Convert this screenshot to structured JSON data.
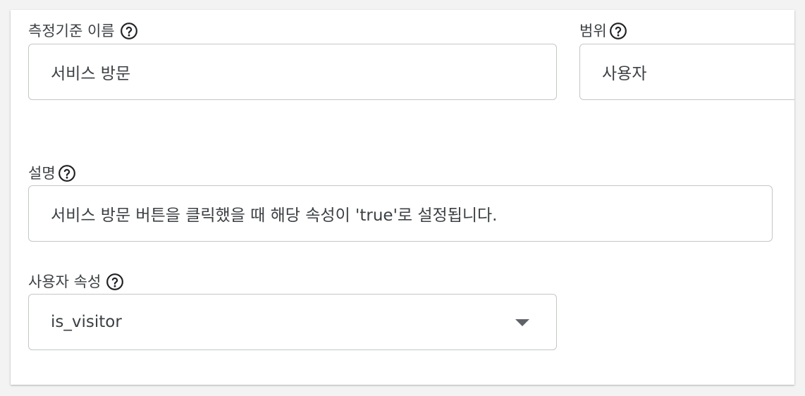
{
  "dimension_name": {
    "label": "측정기준 이름",
    "value": "서비스 방문",
    "help_icon": "help-circle-icon"
  },
  "scope": {
    "label": "범위",
    "value": "사용자",
    "help_icon": "help-circle-icon"
  },
  "description": {
    "label": "설명",
    "value": "서비스 방문 버튼을 클릭했을 때 해당 속성이 'true'로 설정됩니다.",
    "help_icon": "help-circle-icon"
  },
  "user_property": {
    "label": "사용자 속성",
    "value": "is_visitor",
    "help_icon": "help-circle-icon",
    "dropdown_icon": "dropdown-arrow-icon"
  },
  "colors": {
    "text": "#3c4043",
    "border": "#c4c7c5",
    "icon": "#202124"
  }
}
